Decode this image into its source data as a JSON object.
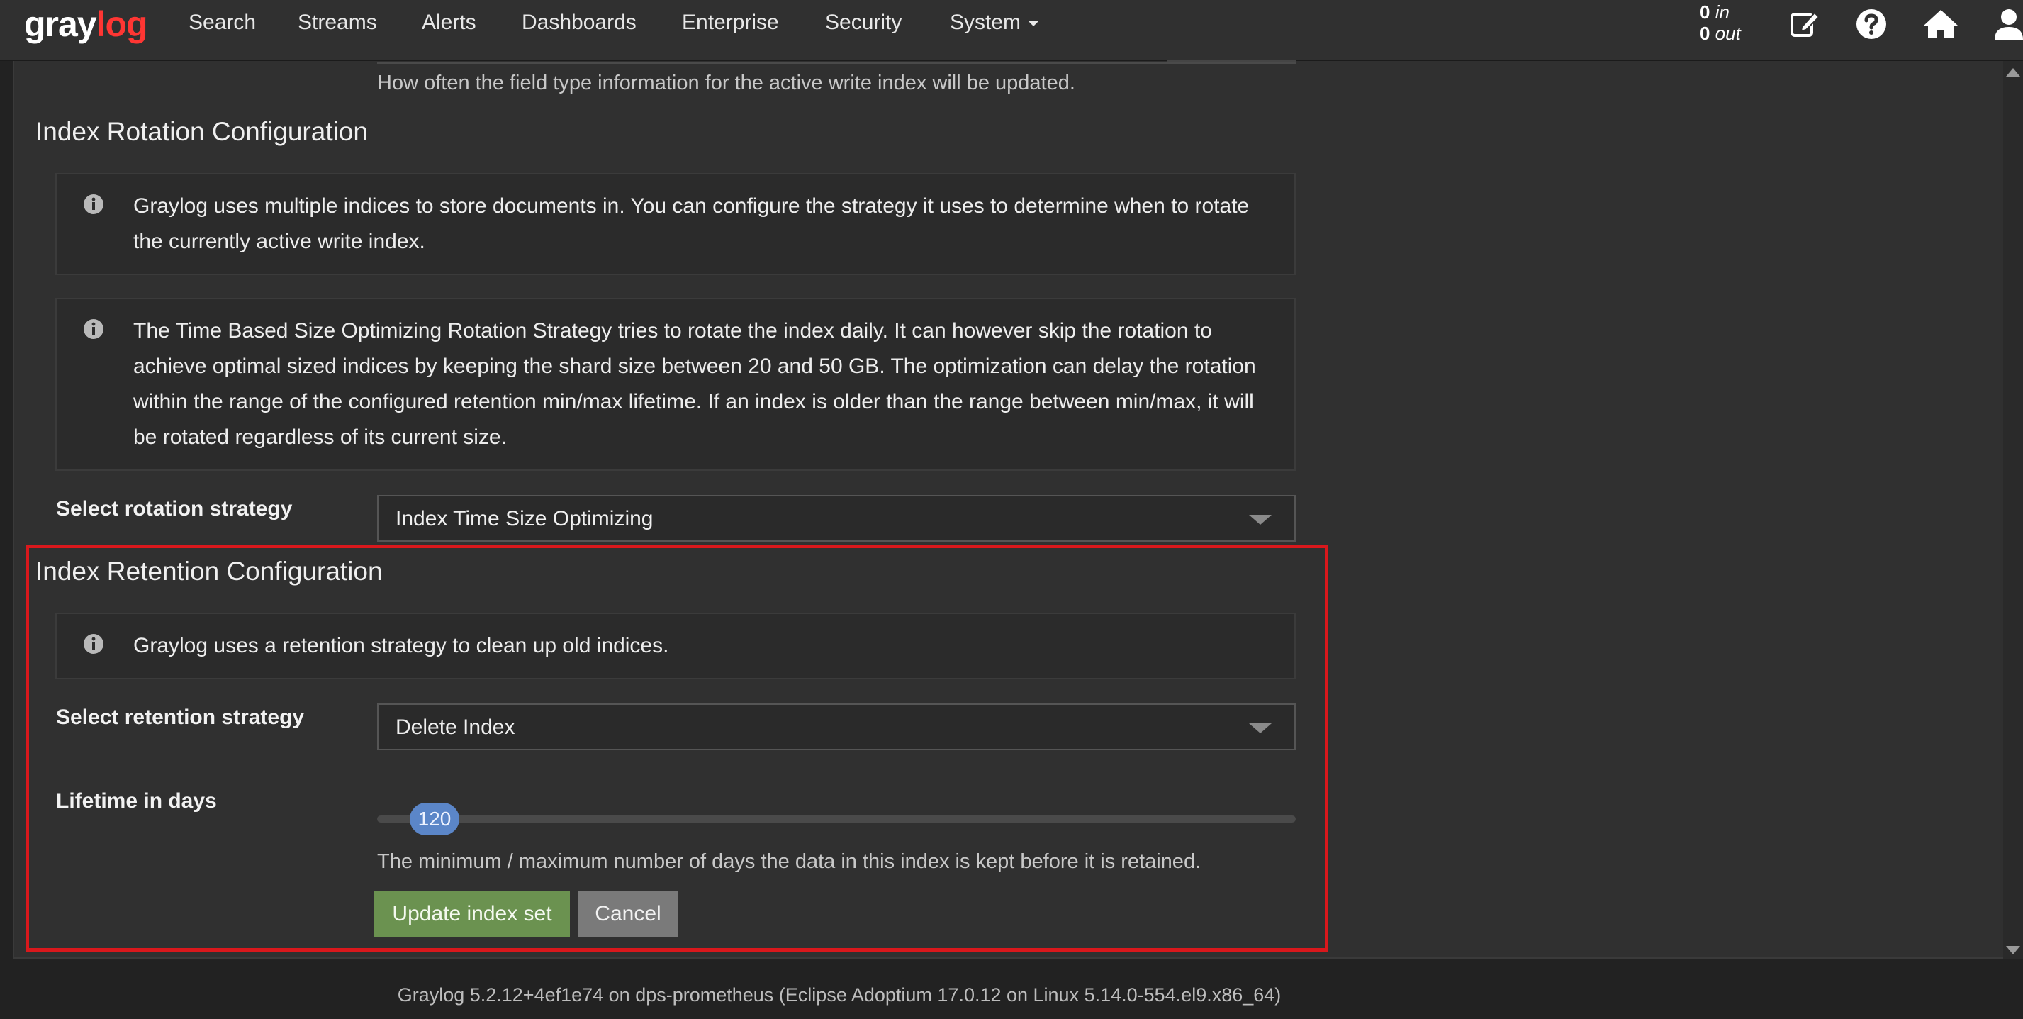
{
  "navbar": {
    "brand_left": "gray",
    "brand_right": "log",
    "items": [
      "Search",
      "Streams",
      "Alerts",
      "Dashboards",
      "Enterprise",
      "Security",
      "System"
    ],
    "throughput": {
      "in_count": "0",
      "in_label": "in",
      "out_count": "0",
      "out_label": "out"
    },
    "icons": [
      "edit-icon",
      "help-icon",
      "home-icon",
      "user-icon"
    ]
  },
  "field_type_refresh": {
    "help": "How often the field type information for the active write index will be updated."
  },
  "rotation": {
    "title": "Index Rotation Configuration",
    "info_1": "Graylog uses multiple indices to store documents in. You can configure the strategy it uses to determine when to rotate the currently active write index.",
    "info_2": "The Time Based Size Optimizing Rotation Strategy tries to rotate the index daily. It can however skip the rotation to achieve optimal sized indices by keeping the shard size between 20 and 50 GB. The optimization can delay the rotation within the range of the configured retention min/max lifetime. If an index is older than the range between min/max, it will be rotated regardless of its current size.",
    "strategy_label": "Select rotation strategy",
    "strategy_value": "Index Time Size Optimizing"
  },
  "retention": {
    "title": "Index Retention Configuration",
    "info": "Graylog uses a retention strategy to clean up old indices.",
    "strategy_label": "Select retention strategy",
    "strategy_value": "Delete Index",
    "lifetime_label": "Lifetime in days",
    "lifetime_value": "120",
    "lifetime_help": "The minimum / maximum number of days the data in this index is kept before it is retained."
  },
  "actions": {
    "update_label": "Update index set",
    "cancel_label": "Cancel"
  },
  "footer": {
    "text": "Graylog 5.2.12+4ef1e74 on dps-prometheus (Eclipse Adoptium 17.0.12 on Linux 5.14.0-554.el9.x86_64)"
  },
  "colors": {
    "brand_accent": "#ff3633",
    "highlight_border": "#d9181c",
    "primary_button": "#6b9250",
    "slider_handle": "#5b86c8"
  }
}
